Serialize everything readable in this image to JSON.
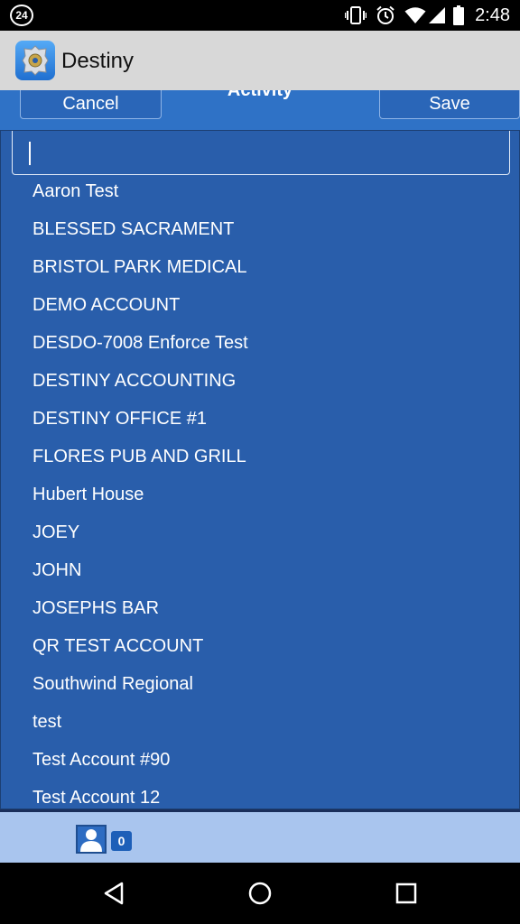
{
  "status_bar": {
    "badge": "24",
    "time": "2:48",
    "icons": [
      "vibrate-icon",
      "alarm-icon",
      "wifi-icon",
      "signal-icon",
      "battery-icon"
    ]
  },
  "app_bar": {
    "title": "Destiny",
    "icon": "police-badge-icon"
  },
  "toolbar": {
    "cancel_label": "Cancel",
    "title": "Activity",
    "save_label": "Save"
  },
  "search": {
    "value": "",
    "placeholder": ""
  },
  "accounts": [
    "Aaron Test",
    "BLESSED SACRAMENT",
    "BRISTOL PARK MEDICAL",
    "DEMO ACCOUNT",
    "DESDO-7008 Enforce Test",
    "DESTINY ACCOUNTING",
    "DESTINY OFFICE #1",
    "FLORES PUB AND GRILL",
    "Hubert House",
    "JOEY",
    "JOHN",
    "JOSEPHS BAR",
    "QR TEST ACCOUNT",
    "Southwind Regional",
    "test",
    "Test Account #90",
    "Test Account 12"
  ],
  "bottom": {
    "user_icon": "user-icon",
    "count": "0"
  },
  "nav": {
    "back": "back-icon",
    "home": "home-icon",
    "recents": "recents-icon"
  },
  "colors": {
    "toolbar": "#2f72c6",
    "panel": "#295eab",
    "bottom_strip": "#a9c5ee",
    "app_bar": "#d8d8d8"
  }
}
